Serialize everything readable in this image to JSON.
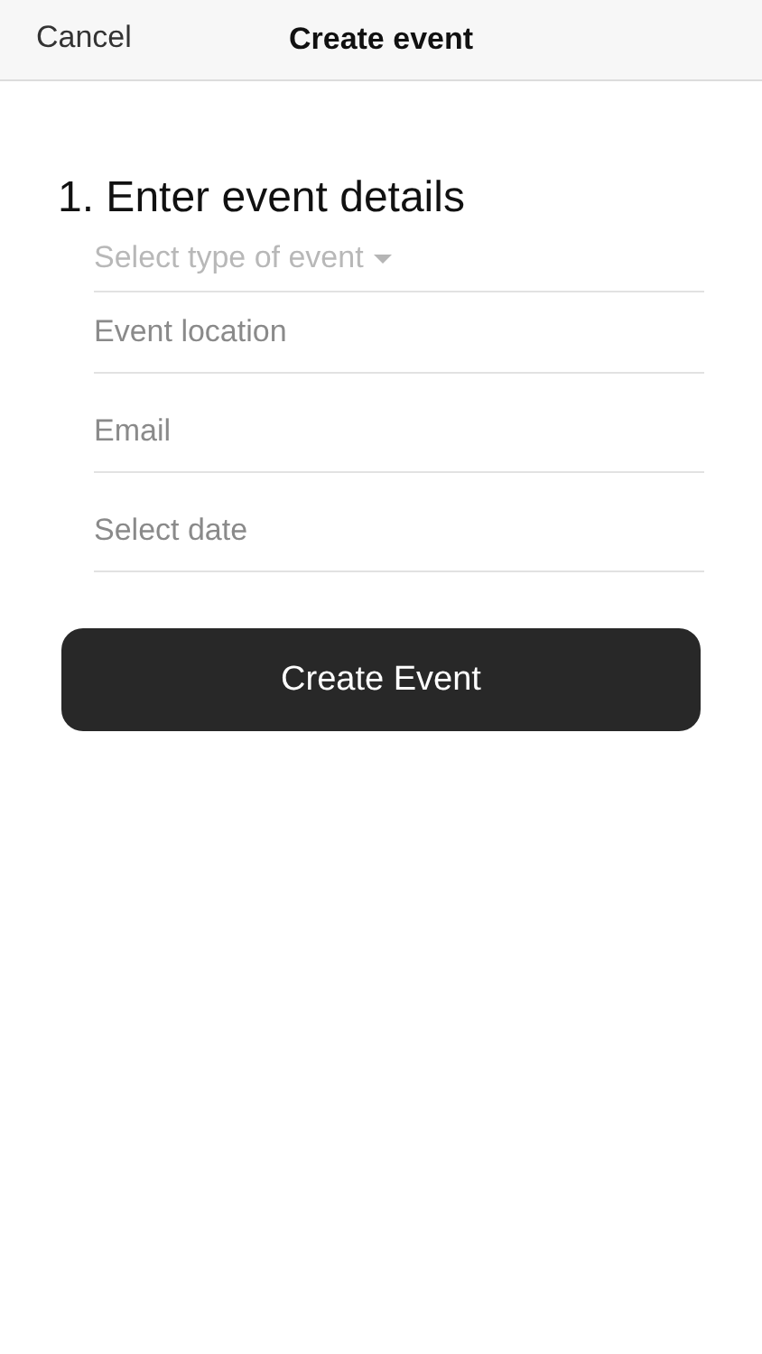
{
  "nav_bar": {
    "cancel": "Cancel",
    "title": "Create event"
  },
  "section_title": "1. Enter event details",
  "fields": [
    {
      "kind": "select",
      "placeholder": "Select type of event"
    },
    {
      "kind": "input",
      "placeholder": "Event location"
    },
    {
      "kind": "input",
      "placeholder": "Email"
    },
    {
      "kind": "input",
      "placeholder": "Select date"
    }
  ],
  "submit_button": "Create Event"
}
